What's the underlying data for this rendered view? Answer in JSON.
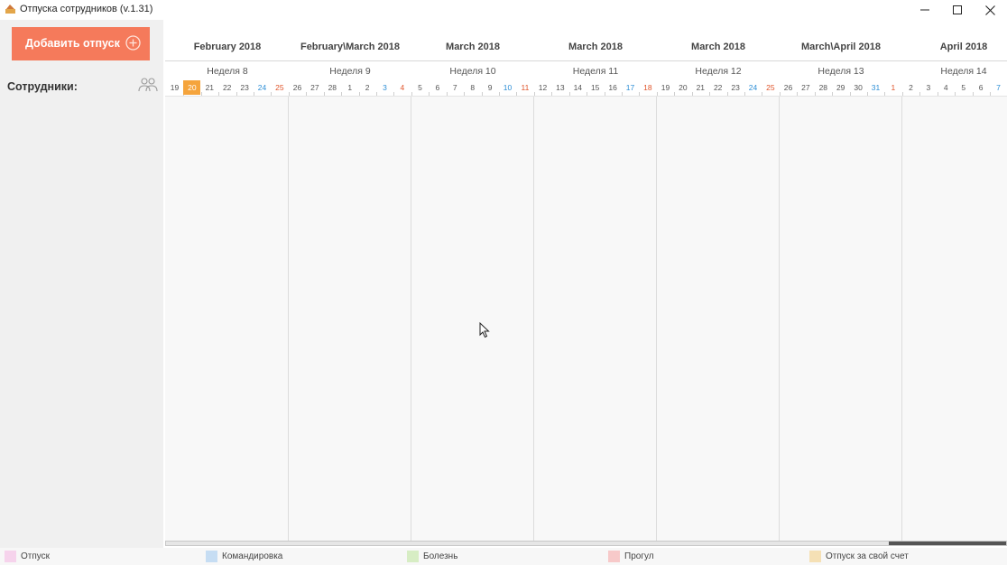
{
  "window": {
    "title": "Отпуска сотрудников (v.1.31)",
    "controls": [
      "minimize-icon",
      "maximize-icon",
      "close-icon"
    ]
  },
  "sidebar": {
    "add_button_label": "Добавить отпуск",
    "add_button_color": "#f57a5b",
    "employees_label": "Сотрудники:"
  },
  "calendar": {
    "months": [
      "February 2018",
      "February\\March 2018",
      "March 2018",
      "March 2018",
      "March 2018",
      "March\\April 2018",
      "April 2018"
    ],
    "weeks": [
      "Неделя 8",
      "Неделя 9",
      "Неделя 10",
      "Неделя 11",
      "Неделя 12",
      "Неделя 13",
      "Неделя 14"
    ],
    "days": [
      [
        "19",
        "20",
        "21",
        "22",
        "23",
        "24",
        "25"
      ],
      [
        "26",
        "27",
        "28",
        "1",
        "2",
        "3",
        "4"
      ],
      [
        "5",
        "6",
        "7",
        "8",
        "9",
        "10",
        "11"
      ],
      [
        "12",
        "13",
        "14",
        "15",
        "16",
        "17",
        "18"
      ],
      [
        "19",
        "20",
        "21",
        "22",
        "23",
        "24",
        "25"
      ],
      [
        "26",
        "27",
        "28",
        "29",
        "30",
        "31",
        "1"
      ],
      [
        "2",
        "3",
        "4",
        "5",
        "6",
        "7"
      ]
    ],
    "today": "20",
    "today_color": "#f5a43c",
    "saturday_color": "#2e8fd6",
    "sunday_color": "#e0552b"
  },
  "legend": [
    {
      "label": "Отпуск",
      "color": "#f6d3ec"
    },
    {
      "label": "Командировка",
      "color": "#c6ddf3"
    },
    {
      "label": "Болезнь",
      "color": "#d7edc4"
    },
    {
      "label": "Прогул",
      "color": "#f7c9c9"
    },
    {
      "label": "Отпуск за свой счет",
      "color": "#f5e0b5"
    }
  ]
}
